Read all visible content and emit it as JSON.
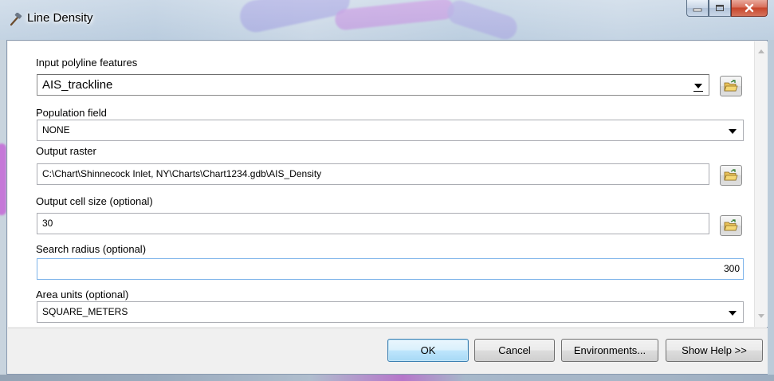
{
  "window": {
    "title": "Line Density"
  },
  "fields": {
    "input_polyline": {
      "label": "Input polyline features",
      "value": "AIS_trackline"
    },
    "population": {
      "label": "Population field",
      "value": "NONE"
    },
    "output_raster": {
      "label": "Output raster",
      "value": "C:\\Chart\\Shinnecock Inlet, NY\\Charts\\Chart1234.gdb\\AIS_Density"
    },
    "cell_size": {
      "label": "Output cell size (optional)",
      "value": "30"
    },
    "search_radius": {
      "label": "Search radius (optional)",
      "value": "300"
    },
    "area_units": {
      "label": "Area units (optional)",
      "value": "SQUARE_METERS"
    }
  },
  "buttons": {
    "ok": "OK",
    "cancel": "Cancel",
    "environments": "Environments...",
    "show_help": "Show Help >>"
  },
  "icons": {
    "title": "hammer-icon",
    "browse": "open-folder-icon"
  }
}
